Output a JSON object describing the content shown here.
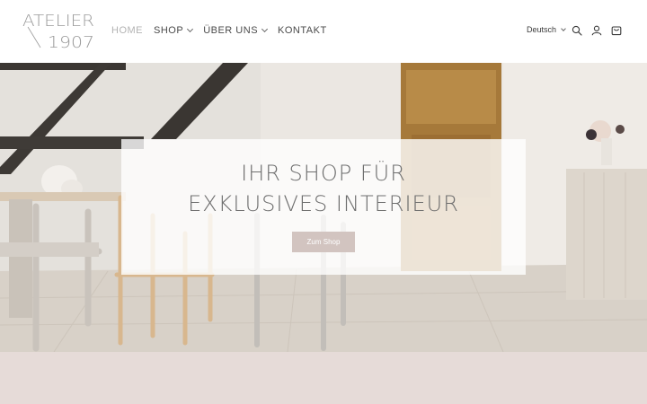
{
  "brand": {
    "line1": "ATELIER",
    "line2": "1907"
  },
  "nav": {
    "items": [
      {
        "label": "HOME",
        "active": true,
        "dropdown": false
      },
      {
        "label": "SHOP",
        "active": false,
        "dropdown": true
      },
      {
        "label": "ÜBER UNS",
        "active": false,
        "dropdown": true
      },
      {
        "label": "KONTAKT",
        "active": false,
        "dropdown": false
      }
    ]
  },
  "header": {
    "language": "Deutsch",
    "icons": [
      "search-icon",
      "account-icon",
      "cart-icon"
    ]
  },
  "hero": {
    "title_line1": "IHR SHOP FÜR",
    "title_line2": "EXKLUSIVES INTERIEUR",
    "cta_label": "Zum Shop"
  },
  "colors": {
    "nav_active": "#b3b3b3",
    "cta_bg": "#d2c4c0",
    "band_bg": "#e6dbd8"
  }
}
